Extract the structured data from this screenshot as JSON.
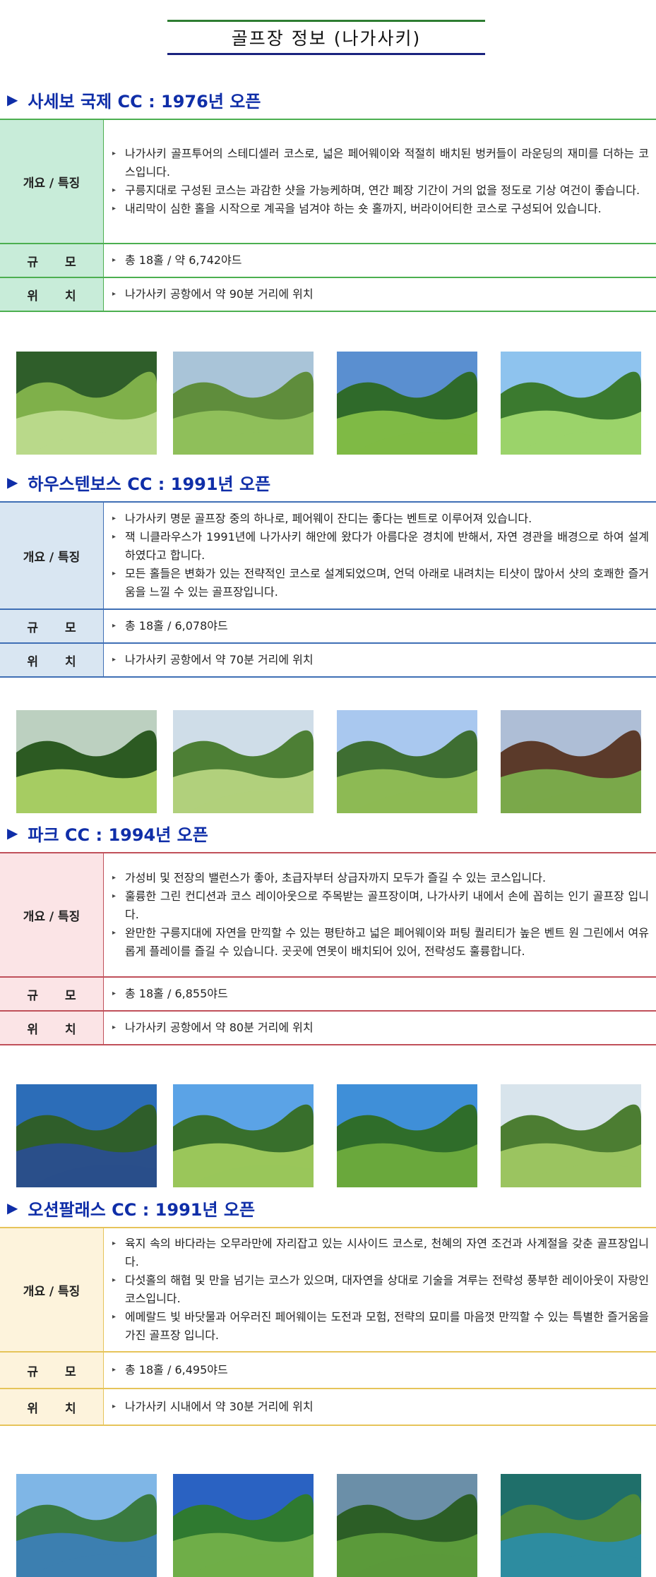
{
  "page_title": "골프장 정보 (나가사키)",
  "labels": {
    "overview": "개요 / 특징",
    "scale": "규 모",
    "location": "위 치"
  },
  "courses": [
    {
      "heading": "사세보 국제 CC : 1976년 오픈",
      "features": [
        "나가사키 골프투어의 스테디셀러 코스로, 넓은 페어웨이와 적절히 배치된 벙커들이 라운딩의 재미를 더하는 코스입니다.",
        "구릉지대로 구성된 코스는 과감한 샷을 가능케하며, 연간 폐장 기간이 거의 없을 정도로 기상 여건이 좋습니다.",
        "내리막이 심한 홀을 시작으로 계곡을 넘겨야 하는 숏 홀까지, 버라이어티한 코스로 구성되어 있습니다."
      ],
      "scale": "총 18홀 / 약 6,742야드",
      "location": "나가사키 공항에서 약 90분 거리에 위치",
      "accent": "#4caf50",
      "label_bg": "#c8ecd9"
    },
    {
      "heading": "하우스텐보스 CC : 1991년 오픈",
      "features": [
        "나가사키 명문 골프장 중의 하나로, 페어웨이 잔디는 좋다는 벤트로 이루어져 있습니다.",
        "잭 니클라우스가 1991년에 나가사키 해안에 왔다가 아름다운 경치에 반해서, 자연 경관을 배경으로 하여 설계하였다고 합니다.",
        "모든 홀들은 변화가 있는 전략적인 코스로 설계되었으며, 언덕 아래로 내려치는 티샷이 많아서 샷의 호쾌한 즐거움을 느낄 수 있는 골프장입니다."
      ],
      "scale": "총 18홀 / 6,078야드",
      "location": "나가사키 공항에서 약 70분 거리에 위치",
      "accent": "#3f6fb5",
      "label_bg": "#d9e6f2"
    },
    {
      "heading": "파크 CC : 1994년 오픈",
      "features": [
        "가성비 및 전장의 밸런스가 좋아, 초급자부터 상급자까지 모두가 즐길 수 있는 코스입니다.",
        "훌륭한 그린 컨디션과 코스 레이아웃으로 주목받는 골프장이며, 나가사키 내에서 손에 꼽히는 인기 골프장 입니다.",
        "완만한 구릉지대에 자연을 만끽할 수 있는 평탄하고 넓은 페어웨이와 퍼팅 퀄리티가 높은 벤트 원 그린에서 여유롭게 플레이를 즐길 수 있습니다. 곳곳에 연못이 배치되어 있어, 전략성도 훌륭합니다."
      ],
      "scale": "총 18홀 / 6,855야드",
      "location": "나가사키 공항에서 약 80분 거리에 위치",
      "accent": "#c0505a",
      "label_bg": "#fbe4e6"
    },
    {
      "heading": "오션팔래스 CC : 1991년 오픈",
      "features": [
        "육지 속의 바다라는 오무라만에 자리잡고 있는 시사이드 코스로, 천혜의 자연 조건과 사계절을 갖춘 골프장입니다.",
        "다섯홀의 해협 및 만을 넘기는 코스가 있으며, 대자연을 상대로 기술을 겨루는 전략성 풍부한 레이아웃이 자랑인 코스입니다.",
        "에메랄드 빛 바닷물과 어우러진 페어웨이는 도전과 모험, 전략의 묘미를 마음껏 만끽할 수 있는 특별한 즐거움을 가진 골프장 입니다."
      ],
      "scale": "총 18홀 / 6,495야드",
      "location": "나가사키 시내에서 약 30분 거리에 위치",
      "accent": "#e6c45a",
      "label_bg": "#fdf3dc"
    }
  ]
}
